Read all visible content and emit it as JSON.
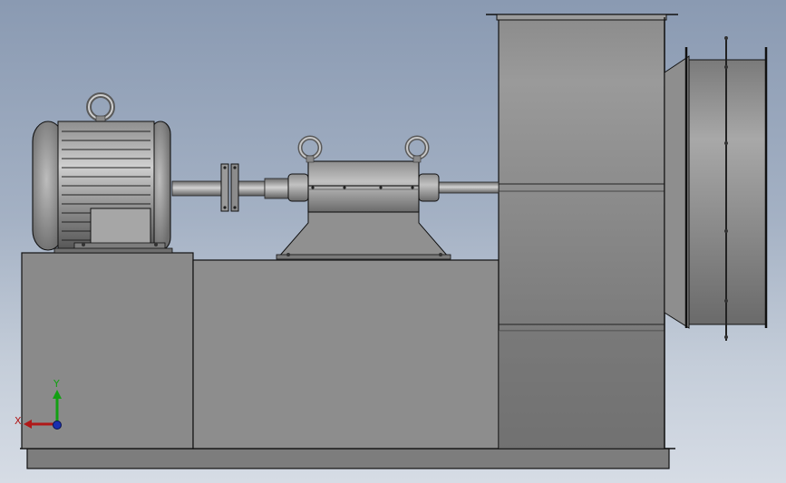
{
  "view": {
    "background_top": "#8a9ab2",
    "background_bottom": "#d6dce5"
  },
  "model": {
    "components": [
      "electric-motor",
      "flange-coupling",
      "bearing-housing",
      "base-frame",
      "fan-housing",
      "inlet-duct",
      "drive-shaft"
    ]
  },
  "triad": {
    "x_label": "X",
    "y_label": "Y",
    "x_color": "#b01818",
    "y_color": "#12a012",
    "z_color": "#1a2fb0"
  }
}
